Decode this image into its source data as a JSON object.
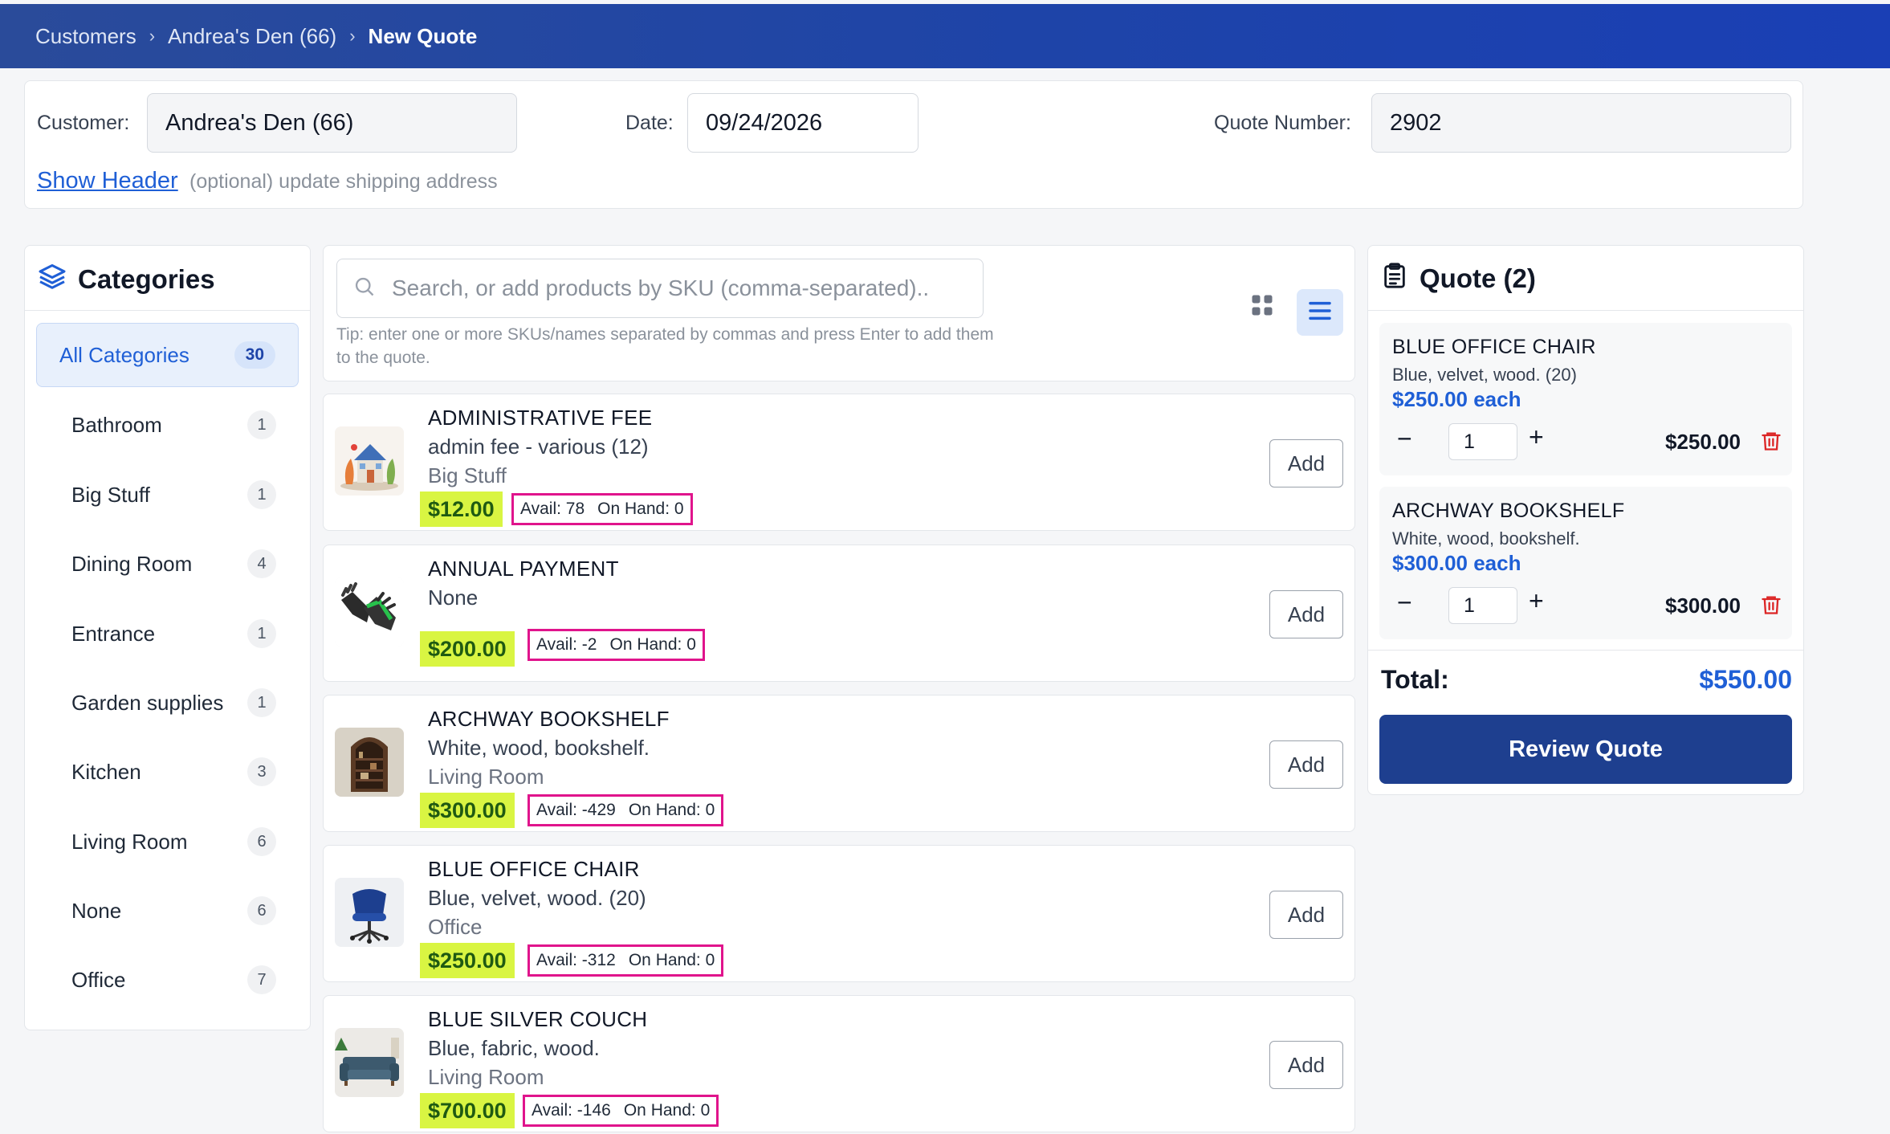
{
  "breadcrumb": {
    "items": [
      "Customers",
      "Andrea's Den (66)"
    ],
    "current": "New Quote",
    "separator": "›"
  },
  "header": {
    "customer_label": "Customer:",
    "customer_value": "Andrea's Den (66)",
    "date_label": "Date:",
    "date_value": "09/24/2026",
    "quote_number_label": "Quote Number:",
    "quote_number_value": "2902",
    "show_header_link": "Show Header",
    "show_header_note": "(optional) update shipping address"
  },
  "categories": {
    "title": "Categories",
    "all_label": "All Categories",
    "all_count": "30",
    "items": [
      {
        "label": "Bathroom",
        "count": "1"
      },
      {
        "label": "Big Stuff",
        "count": "1"
      },
      {
        "label": "Dining Room",
        "count": "4"
      },
      {
        "label": "Entrance",
        "count": "1"
      },
      {
        "label": "Garden supplies",
        "count": "1"
      },
      {
        "label": "Kitchen",
        "count": "3"
      },
      {
        "label": "Living Room",
        "count": "6"
      },
      {
        "label": "None",
        "count": "6"
      },
      {
        "label": "Office",
        "count": "7"
      }
    ]
  },
  "search": {
    "placeholder": "Search, or add products by SKU (comma-separated)..",
    "tip": "Tip: enter one or more SKUs/names separated by commas and press Enter to add them to the quote."
  },
  "products": [
    {
      "name": "ADMINISTRATIVE FEE",
      "desc": "admin fee - various (12)",
      "category": "Big Stuff",
      "price": "$12.00",
      "avail": "Avail: 78",
      "on_hand": "On Hand: 0",
      "add": "Add",
      "icon": "house-illustration-icon"
    },
    {
      "name": "ANNUAL PAYMENT",
      "desc": "None",
      "category": "",
      "price": "$200.00",
      "avail": "Avail: -2",
      "on_hand": "On Hand: 0",
      "add": "Add",
      "icon": "garden-gloves-icon"
    },
    {
      "name": "ARCHWAY BOOKSHELF",
      "desc": "White, wood, bookshelf.",
      "category": "Living Room",
      "price": "$300.00",
      "avail": "Avail: -429",
      "on_hand": "On Hand: 0",
      "add": "Add",
      "icon": "bookshelf-icon"
    },
    {
      "name": "BLUE OFFICE CHAIR",
      "desc": "Blue, velvet, wood. (20)",
      "category": "Office",
      "price": "$250.00",
      "avail": "Avail: -312",
      "on_hand": "On Hand: 0",
      "add": "Add",
      "icon": "office-chair-icon"
    },
    {
      "name": "BLUE SILVER COUCH",
      "desc": "Blue, fabric, wood.",
      "category": "Living Room",
      "price": "$700.00",
      "avail": "Avail: -146",
      "on_hand": "On Hand: 0",
      "add": "Add",
      "icon": "couch-icon"
    }
  ],
  "quote": {
    "title": "Quote (2)",
    "items": [
      {
        "name": "BLUE OFFICE CHAIR",
        "desc": "Blue, velvet, wood. (20)",
        "price_each": "$250.00 each",
        "qty": "1",
        "line_total": "$250.00"
      },
      {
        "name": "ARCHWAY BOOKSHELF",
        "desc": "White, wood, bookshelf.",
        "price_each": "$300.00 each",
        "qty": "1",
        "line_total": "$300.00"
      }
    ],
    "total_label": "Total:",
    "total_value": "$550.00",
    "review_button": "Review Quote"
  },
  "colors": {
    "topbar": "#1e44a8",
    "accent": "#1f5fd6",
    "price_highlight": "#d9f542",
    "stock_border": "#e0148c",
    "review_button": "#1e3f8f",
    "trash": "#dc2626"
  }
}
